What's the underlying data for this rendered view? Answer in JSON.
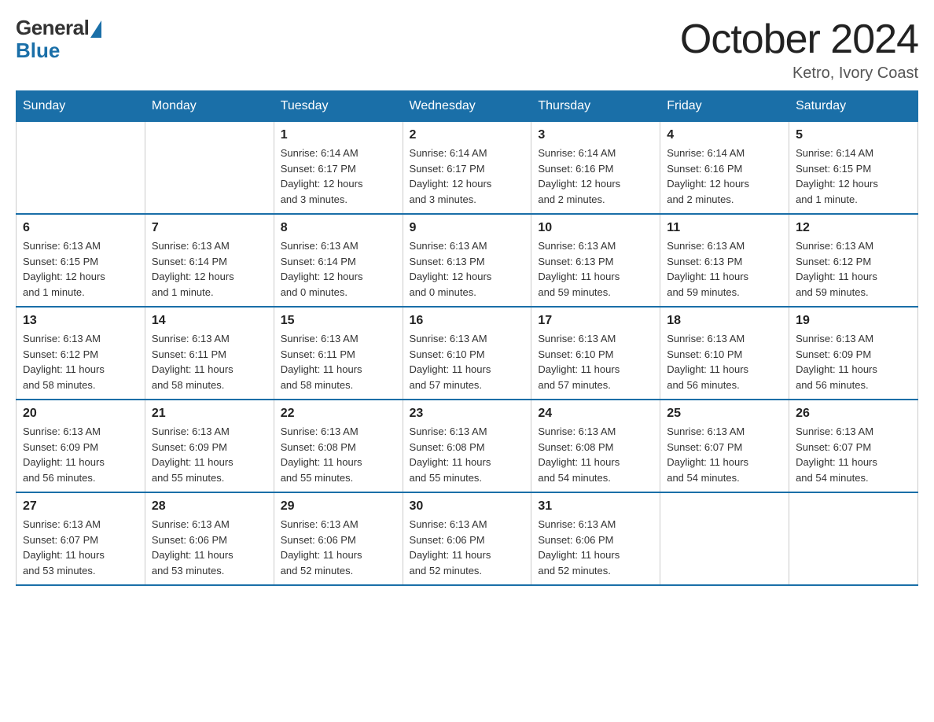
{
  "logo": {
    "general": "General",
    "blue": "Blue"
  },
  "title": "October 2024",
  "location": "Ketro, Ivory Coast",
  "days_of_week": [
    "Sunday",
    "Monday",
    "Tuesday",
    "Wednesday",
    "Thursday",
    "Friday",
    "Saturday"
  ],
  "weeks": [
    [
      {
        "day": "",
        "info": ""
      },
      {
        "day": "",
        "info": ""
      },
      {
        "day": "1",
        "info": "Sunrise: 6:14 AM\nSunset: 6:17 PM\nDaylight: 12 hours\nand 3 minutes."
      },
      {
        "day": "2",
        "info": "Sunrise: 6:14 AM\nSunset: 6:17 PM\nDaylight: 12 hours\nand 3 minutes."
      },
      {
        "day": "3",
        "info": "Sunrise: 6:14 AM\nSunset: 6:16 PM\nDaylight: 12 hours\nand 2 minutes."
      },
      {
        "day": "4",
        "info": "Sunrise: 6:14 AM\nSunset: 6:16 PM\nDaylight: 12 hours\nand 2 minutes."
      },
      {
        "day": "5",
        "info": "Sunrise: 6:14 AM\nSunset: 6:15 PM\nDaylight: 12 hours\nand 1 minute."
      }
    ],
    [
      {
        "day": "6",
        "info": "Sunrise: 6:13 AM\nSunset: 6:15 PM\nDaylight: 12 hours\nand 1 minute."
      },
      {
        "day": "7",
        "info": "Sunrise: 6:13 AM\nSunset: 6:14 PM\nDaylight: 12 hours\nand 1 minute."
      },
      {
        "day": "8",
        "info": "Sunrise: 6:13 AM\nSunset: 6:14 PM\nDaylight: 12 hours\nand 0 minutes."
      },
      {
        "day": "9",
        "info": "Sunrise: 6:13 AM\nSunset: 6:13 PM\nDaylight: 12 hours\nand 0 minutes."
      },
      {
        "day": "10",
        "info": "Sunrise: 6:13 AM\nSunset: 6:13 PM\nDaylight: 11 hours\nand 59 minutes."
      },
      {
        "day": "11",
        "info": "Sunrise: 6:13 AM\nSunset: 6:13 PM\nDaylight: 11 hours\nand 59 minutes."
      },
      {
        "day": "12",
        "info": "Sunrise: 6:13 AM\nSunset: 6:12 PM\nDaylight: 11 hours\nand 59 minutes."
      }
    ],
    [
      {
        "day": "13",
        "info": "Sunrise: 6:13 AM\nSunset: 6:12 PM\nDaylight: 11 hours\nand 58 minutes."
      },
      {
        "day": "14",
        "info": "Sunrise: 6:13 AM\nSunset: 6:11 PM\nDaylight: 11 hours\nand 58 minutes."
      },
      {
        "day": "15",
        "info": "Sunrise: 6:13 AM\nSunset: 6:11 PM\nDaylight: 11 hours\nand 58 minutes."
      },
      {
        "day": "16",
        "info": "Sunrise: 6:13 AM\nSunset: 6:10 PM\nDaylight: 11 hours\nand 57 minutes."
      },
      {
        "day": "17",
        "info": "Sunrise: 6:13 AM\nSunset: 6:10 PM\nDaylight: 11 hours\nand 57 minutes."
      },
      {
        "day": "18",
        "info": "Sunrise: 6:13 AM\nSunset: 6:10 PM\nDaylight: 11 hours\nand 56 minutes."
      },
      {
        "day": "19",
        "info": "Sunrise: 6:13 AM\nSunset: 6:09 PM\nDaylight: 11 hours\nand 56 minutes."
      }
    ],
    [
      {
        "day": "20",
        "info": "Sunrise: 6:13 AM\nSunset: 6:09 PM\nDaylight: 11 hours\nand 56 minutes."
      },
      {
        "day": "21",
        "info": "Sunrise: 6:13 AM\nSunset: 6:09 PM\nDaylight: 11 hours\nand 55 minutes."
      },
      {
        "day": "22",
        "info": "Sunrise: 6:13 AM\nSunset: 6:08 PM\nDaylight: 11 hours\nand 55 minutes."
      },
      {
        "day": "23",
        "info": "Sunrise: 6:13 AM\nSunset: 6:08 PM\nDaylight: 11 hours\nand 55 minutes."
      },
      {
        "day": "24",
        "info": "Sunrise: 6:13 AM\nSunset: 6:08 PM\nDaylight: 11 hours\nand 54 minutes."
      },
      {
        "day": "25",
        "info": "Sunrise: 6:13 AM\nSunset: 6:07 PM\nDaylight: 11 hours\nand 54 minutes."
      },
      {
        "day": "26",
        "info": "Sunrise: 6:13 AM\nSunset: 6:07 PM\nDaylight: 11 hours\nand 54 minutes."
      }
    ],
    [
      {
        "day": "27",
        "info": "Sunrise: 6:13 AM\nSunset: 6:07 PM\nDaylight: 11 hours\nand 53 minutes."
      },
      {
        "day": "28",
        "info": "Sunrise: 6:13 AM\nSunset: 6:06 PM\nDaylight: 11 hours\nand 53 minutes."
      },
      {
        "day": "29",
        "info": "Sunrise: 6:13 AM\nSunset: 6:06 PM\nDaylight: 11 hours\nand 52 minutes."
      },
      {
        "day": "30",
        "info": "Sunrise: 6:13 AM\nSunset: 6:06 PM\nDaylight: 11 hours\nand 52 minutes."
      },
      {
        "day": "31",
        "info": "Sunrise: 6:13 AM\nSunset: 6:06 PM\nDaylight: 11 hours\nand 52 minutes."
      },
      {
        "day": "",
        "info": ""
      },
      {
        "day": "",
        "info": ""
      }
    ]
  ]
}
